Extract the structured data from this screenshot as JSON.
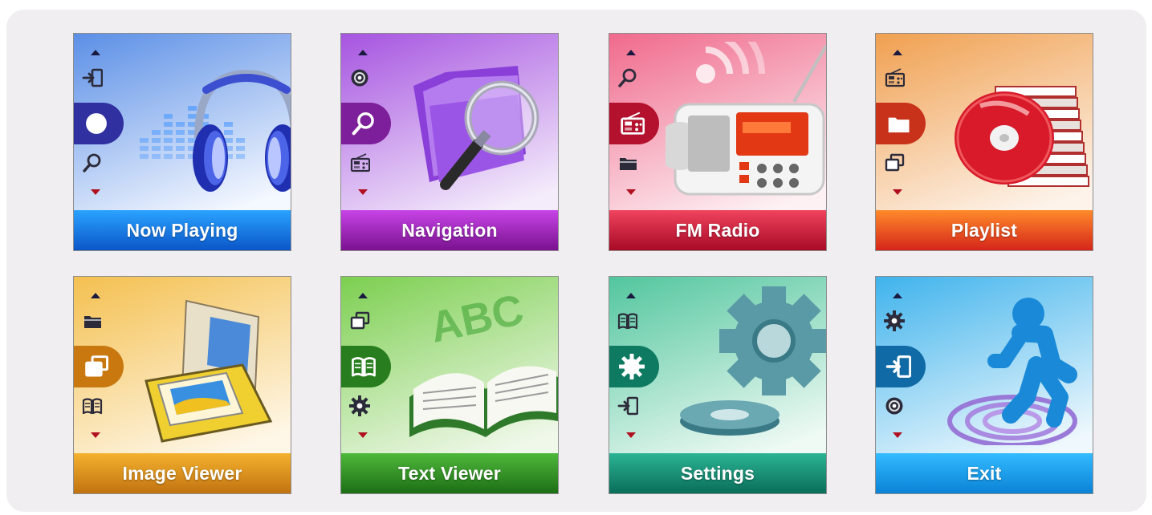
{
  "menu": {
    "tiles": [
      {
        "label": "Now Playing",
        "icon": "headphones-icon",
        "bar_top": "#2aa3ff",
        "bar_bottom": "#0b56c8",
        "bg_top": "#5b8fe6",
        "bg_bottom": "#f4f8ff",
        "rail": "#3030a0",
        "rail_icons": [
          "exit-icon",
          "disc-icon",
          "magnifier-icon"
        ]
      },
      {
        "label": "Navigation",
        "icon": "magnifier-folder-icon",
        "bar_top": "#c744e6",
        "bar_bottom": "#7a1290",
        "bg_top": "#a654e0",
        "bg_bottom": "#f4ecfb",
        "rail": "#7d1e9a",
        "rail_icons": [
          "disc-icon",
          "magnifier-icon",
          "radio-icon"
        ]
      },
      {
        "label": "FM Radio",
        "icon": "radio-icon",
        "bar_top": "#f0435e",
        "bar_bottom": "#a80a26",
        "bg_top": "#f06a8c",
        "bg_bottom": "#fdf1f4",
        "rail": "#b3112d",
        "rail_icons": [
          "magnifier-icon",
          "radio-icon",
          "folder-icon"
        ]
      },
      {
        "label": "Playlist",
        "icon": "cd-stack-icon",
        "bar_top": "#ff8a2a",
        "bar_bottom": "#d5261a",
        "bg_top": "#f0a050",
        "bg_bottom": "#fdf3ea",
        "rail": "#c8311a",
        "rail_icons": [
          "radio-icon",
          "folder-icon",
          "window-icon"
        ]
      },
      {
        "label": "Image Viewer",
        "icon": "photo-album-icon",
        "bar_top": "#f4b22e",
        "bar_bottom": "#c27210",
        "bg_top": "#f4c050",
        "bg_bottom": "#fef7e8",
        "rail": "#c8780f",
        "rail_icons": [
          "folder-icon",
          "window-icon",
          "book-icon"
        ]
      },
      {
        "label": "Text Viewer",
        "icon": "open-book-icon",
        "bar_top": "#4eb83a",
        "bar_bottom": "#1d6e16",
        "bg_top": "#7ccf50",
        "bg_bottom": "#f0f8ea",
        "rail": "#287e1e",
        "rail_icons": [
          "window-icon",
          "book-icon",
          "gear-icon"
        ]
      },
      {
        "label": "Settings",
        "icon": "gear-icon",
        "bar_top": "#2bb494",
        "bar_bottom": "#0a6e5a",
        "bg_top": "#52c69e",
        "bg_bottom": "#effaf5",
        "rail": "#0f7a62",
        "rail_icons": [
          "book-icon",
          "gear-icon",
          "exit-icon"
        ]
      },
      {
        "label": "Exit",
        "icon": "running-man-icon",
        "bar_top": "#33bbff",
        "bar_bottom": "#0a82d6",
        "bg_top": "#3fb3ec",
        "bg_bottom": "#eef8fd",
        "rail": "#0f6aa6",
        "rail_icons": [
          "gear-icon",
          "exit-icon",
          "disc-icon"
        ]
      }
    ]
  }
}
